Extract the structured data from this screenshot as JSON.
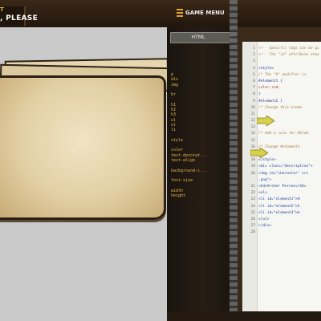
{
  "header": {
    "title_top": "T",
    "title_main": ", PLEASE",
    "menu_label": "GAME MENU"
  },
  "panel": {
    "dropdown_label": "HTML",
    "tags": [
      "p",
      "div",
      "img",
      "",
      "br",
      "",
      "h1",
      "h2",
      "h3",
      "ul",
      "ol",
      "li",
      "",
      "style",
      "",
      "color",
      "text-decorat...",
      "text-align",
      "",
      "background-c...",
      "",
      "font-size",
      "",
      "width",
      "height"
    ]
  },
  "editor": {
    "lines": [
      {
        "n": "1",
        "text": "<!-- Specific tags can be gi",
        "kind": "comment"
      },
      {
        "n": "2",
        "text": "<!-- The \"id\" attribute shou",
        "kind": "comment"
      },
      {
        "n": "3",
        "text": "",
        "kind": "css"
      },
      {
        "n": "4",
        "text": "<style>",
        "kind": "html"
      },
      {
        "n": "5",
        "text": "  /* The \"#\" modifier is ",
        "kind": "comment"
      },
      {
        "n": "6",
        "text": "  #element1 {",
        "kind": "css"
      },
      {
        "n": "7",
        "text": "      color:red;",
        "kind": "red"
      },
      {
        "n": "8",
        "text": "  }",
        "kind": "css"
      },
      {
        "n": "9",
        "text": "  #element2 {",
        "kind": "css"
      },
      {
        "n": "10",
        "text": "    /* Change this eleme",
        "kind": "comment"
      },
      {
        "n": "11",
        "text": "",
        "kind": "css"
      },
      {
        "n": "12",
        "text": "  }",
        "kind": "css"
      },
      {
        "n": "13",
        "text": "",
        "kind": "css"
      },
      {
        "n": "14",
        "text": "  /* Add a rule for #elem",
        "kind": "comment"
      },
      {
        "n": "15",
        "text": "",
        "kind": "css"
      },
      {
        "n": "16",
        "text": "    /* Change #element3",
        "kind": "comment"
      },
      {
        "n": "17",
        "text": "",
        "kind": "css"
      },
      {
        "n": "18",
        "text": "</style>",
        "kind": "html"
      },
      {
        "n": "19",
        "text": "<div class=\"description\">",
        "kind": "html"
      },
      {
        "n": "20",
        "text": "  <img id=\"character\" src",
        "kind": "html"
      },
      {
        "n": "",
        "text": "      .png\">",
        "kind": "html"
      },
      {
        "n": "21",
        "text": "  <h4>Archer Person</h4>",
        "kind": "html"
      },
      {
        "n": "22",
        "text": "  <ul>",
        "kind": "html"
      },
      {
        "n": "23",
        "text": "    <li id=\"element1\">H",
        "kind": "html"
      },
      {
        "n": "24",
        "text": "    <li id=\"element2\">S",
        "kind": "html"
      },
      {
        "n": "25",
        "text": "    <li id=\"element3\">A",
        "kind": "html"
      },
      {
        "n": "26",
        "text": "  </ul>",
        "kind": "html"
      },
      {
        "n": "27",
        "text": "</div>",
        "kind": "html"
      },
      {
        "n": "28",
        "text": "",
        "kind": "css"
      }
    ]
  },
  "colors": {
    "accent": "#e0a53a",
    "tag_text": "#e8b84a",
    "arrow": "#d8d04a"
  }
}
